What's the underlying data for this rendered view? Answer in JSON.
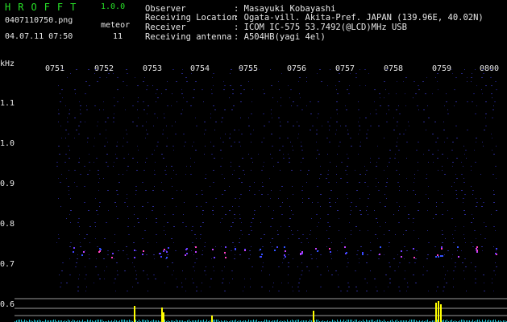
{
  "app": {
    "name": "HROFFT",
    "version": "1.0.0"
  },
  "file": {
    "name": "0407110750.png",
    "datetime": "04.07.11 07:50"
  },
  "meteor": {
    "label": "meteor",
    "count": "11"
  },
  "info": [
    {
      "key": "Observer",
      "value": ": Masayuki Kobayashi"
    },
    {
      "key": "Receiving Location",
      "value": ": Ogata-vill. Akita-Pref. JAPAN (139.96E, 40.02N)"
    },
    {
      "key": "Receiver",
      "value": ": ICOM IC-575 53.7492(@LCD)MHz USB"
    },
    {
      "key": "Receiving antenna",
      "value": ": A504HB(yagi 4el)"
    }
  ],
  "axis": {
    "unit": "kHz",
    "time_ticks": [
      "0751",
      "0752",
      "0753",
      "0754",
      "0755",
      "0756",
      "0757",
      "0758",
      "0759",
      "0800"
    ],
    "freq_ticks": [
      "1.1",
      "1.0",
      "0.9",
      "0.8",
      "0.7",
      "0.6"
    ]
  },
  "colors": {
    "app_title": "#27e027",
    "text": "#e8e8e8",
    "spectrum_bg": "#000010",
    "grid": "#1a1a66",
    "signal": "#ffff00",
    "baseline": "#20c8d8"
  }
}
